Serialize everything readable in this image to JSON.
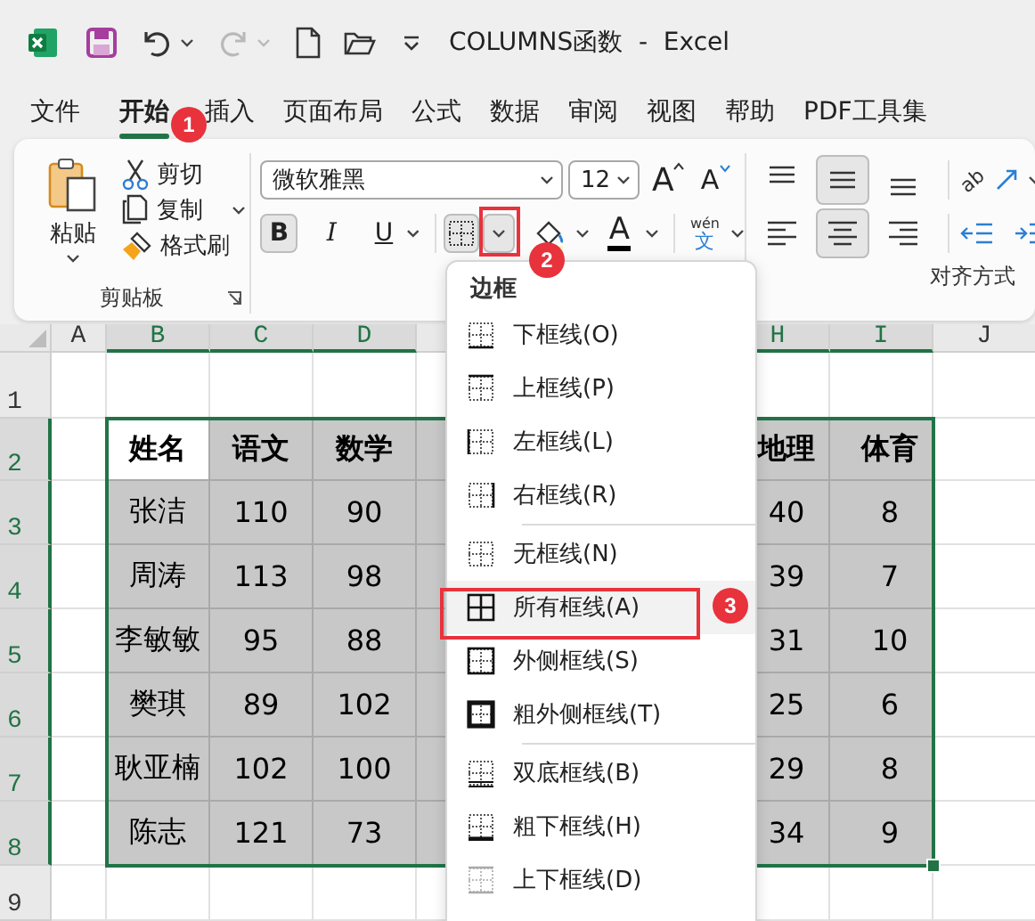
{
  "title_bar": {
    "title": "COLUMNS函数  -  Excel",
    "redo_disabled": true
  },
  "ribbon_tabs": [
    {
      "label": "文件",
      "selected": false
    },
    {
      "label": "开始",
      "selected": true
    },
    {
      "label": "插入",
      "selected": false
    },
    {
      "label": "页面布局",
      "selected": false
    },
    {
      "label": "公式",
      "selected": false
    },
    {
      "label": "数据",
      "selected": false
    },
    {
      "label": "审阅",
      "selected": false
    },
    {
      "label": "视图",
      "selected": false
    },
    {
      "label": "帮助",
      "selected": false
    },
    {
      "label": "PDF工具集",
      "selected": false
    }
  ],
  "clipboard": {
    "paste": "粘贴",
    "cut": "剪切",
    "copy": "复制",
    "format_painter": "格式刷",
    "group_label": "剪贴板"
  },
  "font": {
    "name": "微软雅黑",
    "size": "12",
    "grow": "A",
    "shrink": "A",
    "bold": {
      "label": "B",
      "selected": true
    },
    "italic": {
      "label": "I",
      "selected": false
    },
    "underline": {
      "label": "U",
      "selected": false
    },
    "font_color": "A",
    "phonetic_top": "wén",
    "phonetic_bottom": "文"
  },
  "alignment": {
    "vertical": [
      {
        "kind": "top",
        "selected": false
      },
      {
        "kind": "middle",
        "selected": true
      },
      {
        "kind": "bottom",
        "selected": false
      }
    ],
    "orientation": "ab",
    "horizontal": [
      {
        "kind": "left",
        "selected": false
      },
      {
        "kind": "center",
        "selected": true
      },
      {
        "kind": "right",
        "selected": false
      }
    ],
    "group_label": "对齐方式"
  },
  "sheet": {
    "columns_left": [
      {
        "label": "A",
        "selected": false
      },
      {
        "label": "B",
        "selected": true
      },
      {
        "label": "C",
        "selected": true
      },
      {
        "label": "D",
        "selected": true
      }
    ],
    "columns_right": [
      {
        "label": "H",
        "selected": true
      },
      {
        "label": "I",
        "selected": true
      },
      {
        "label": "J",
        "selected": false
      }
    ],
    "rows": [
      {
        "label": "1",
        "selected": false,
        "kind": "empty"
      },
      {
        "label": "2",
        "selected": true,
        "kind": "header",
        "left": [
          {
            "text": "姓名",
            "shaded": false
          },
          {
            "text": "语文",
            "shaded": true
          },
          {
            "text": "数学",
            "shaded": true
          }
        ],
        "right": [
          {
            "text": "地理",
            "shaded": true
          },
          {
            "text": "体育",
            "shaded": true
          }
        ]
      },
      {
        "label": "3",
        "selected": true,
        "kind": "data",
        "left": [
          {
            "text": "张洁",
            "shaded": true
          },
          {
            "text": "110",
            "shaded": true
          },
          {
            "text": "90",
            "shaded": true
          }
        ],
        "right": [
          {
            "text": "40",
            "shaded": true
          },
          {
            "text": "8",
            "shaded": true
          }
        ]
      },
      {
        "label": "4",
        "selected": true,
        "kind": "data",
        "left": [
          {
            "text": "周涛",
            "shaded": true
          },
          {
            "text": "113",
            "shaded": true
          },
          {
            "text": "98",
            "shaded": true
          }
        ],
        "right": [
          {
            "text": "39",
            "shaded": true
          },
          {
            "text": "7",
            "shaded": true
          }
        ]
      },
      {
        "label": "5",
        "selected": true,
        "kind": "data",
        "left": [
          {
            "text": "李敏敏",
            "shaded": true
          },
          {
            "text": "95",
            "shaded": true
          },
          {
            "text": "88",
            "shaded": true
          }
        ],
        "right": [
          {
            "text": "31",
            "shaded": true
          },
          {
            "text": "10",
            "shaded": true
          }
        ]
      },
      {
        "label": "6",
        "selected": true,
        "kind": "data",
        "left": [
          {
            "text": "樊琪",
            "shaded": true
          },
          {
            "text": "89",
            "shaded": true
          },
          {
            "text": "102",
            "shaded": true
          }
        ],
        "right": [
          {
            "text": "25",
            "shaded": true
          },
          {
            "text": "6",
            "shaded": true
          }
        ]
      },
      {
        "label": "7",
        "selected": true,
        "kind": "data",
        "left": [
          {
            "text": "耿亚楠",
            "shaded": true
          },
          {
            "text": "102",
            "shaded": true
          },
          {
            "text": "100",
            "shaded": true
          }
        ],
        "right": [
          {
            "text": "29",
            "shaded": true
          },
          {
            "text": "8",
            "shaded": true
          }
        ]
      },
      {
        "label": "8",
        "selected": true,
        "kind": "data",
        "left": [
          {
            "text": "陈志",
            "shaded": true
          },
          {
            "text": "121",
            "shaded": true
          },
          {
            "text": "73",
            "shaded": true
          }
        ],
        "right": [
          {
            "text": "34",
            "shaded": true
          },
          {
            "text": "9",
            "shaded": true
          }
        ]
      },
      {
        "label": "9",
        "selected": false,
        "kind": "empty"
      }
    ]
  },
  "border_menu": {
    "title": "边框",
    "groups": [
      [
        {
          "label": "下框线(O)",
          "kind": "bottom",
          "selected": false
        },
        {
          "label": "上框线(P)",
          "kind": "top",
          "selected": false
        },
        {
          "label": "左框线(L)",
          "kind": "left",
          "selected": false
        },
        {
          "label": "右框线(R)",
          "kind": "right",
          "selected": false
        }
      ],
      [
        {
          "label": "无框线(N)",
          "kind": "none",
          "selected": false
        },
        {
          "label": "所有框线(A)",
          "kind": "all",
          "selected": true
        },
        {
          "label": "外侧框线(S)",
          "kind": "outside",
          "selected": false
        },
        {
          "label": "粗外侧框线(T)",
          "kind": "thick-outside",
          "selected": false
        }
      ],
      [
        {
          "label": "双底框线(B)",
          "kind": "double-bottom",
          "selected": false
        },
        {
          "label": "粗下框线(H)",
          "kind": "thick-bottom",
          "selected": false
        },
        {
          "label": "上下框线(D)",
          "kind": "top-bottom",
          "selected": false
        }
      ]
    ]
  },
  "callouts": [
    "1",
    "2",
    "3"
  ]
}
